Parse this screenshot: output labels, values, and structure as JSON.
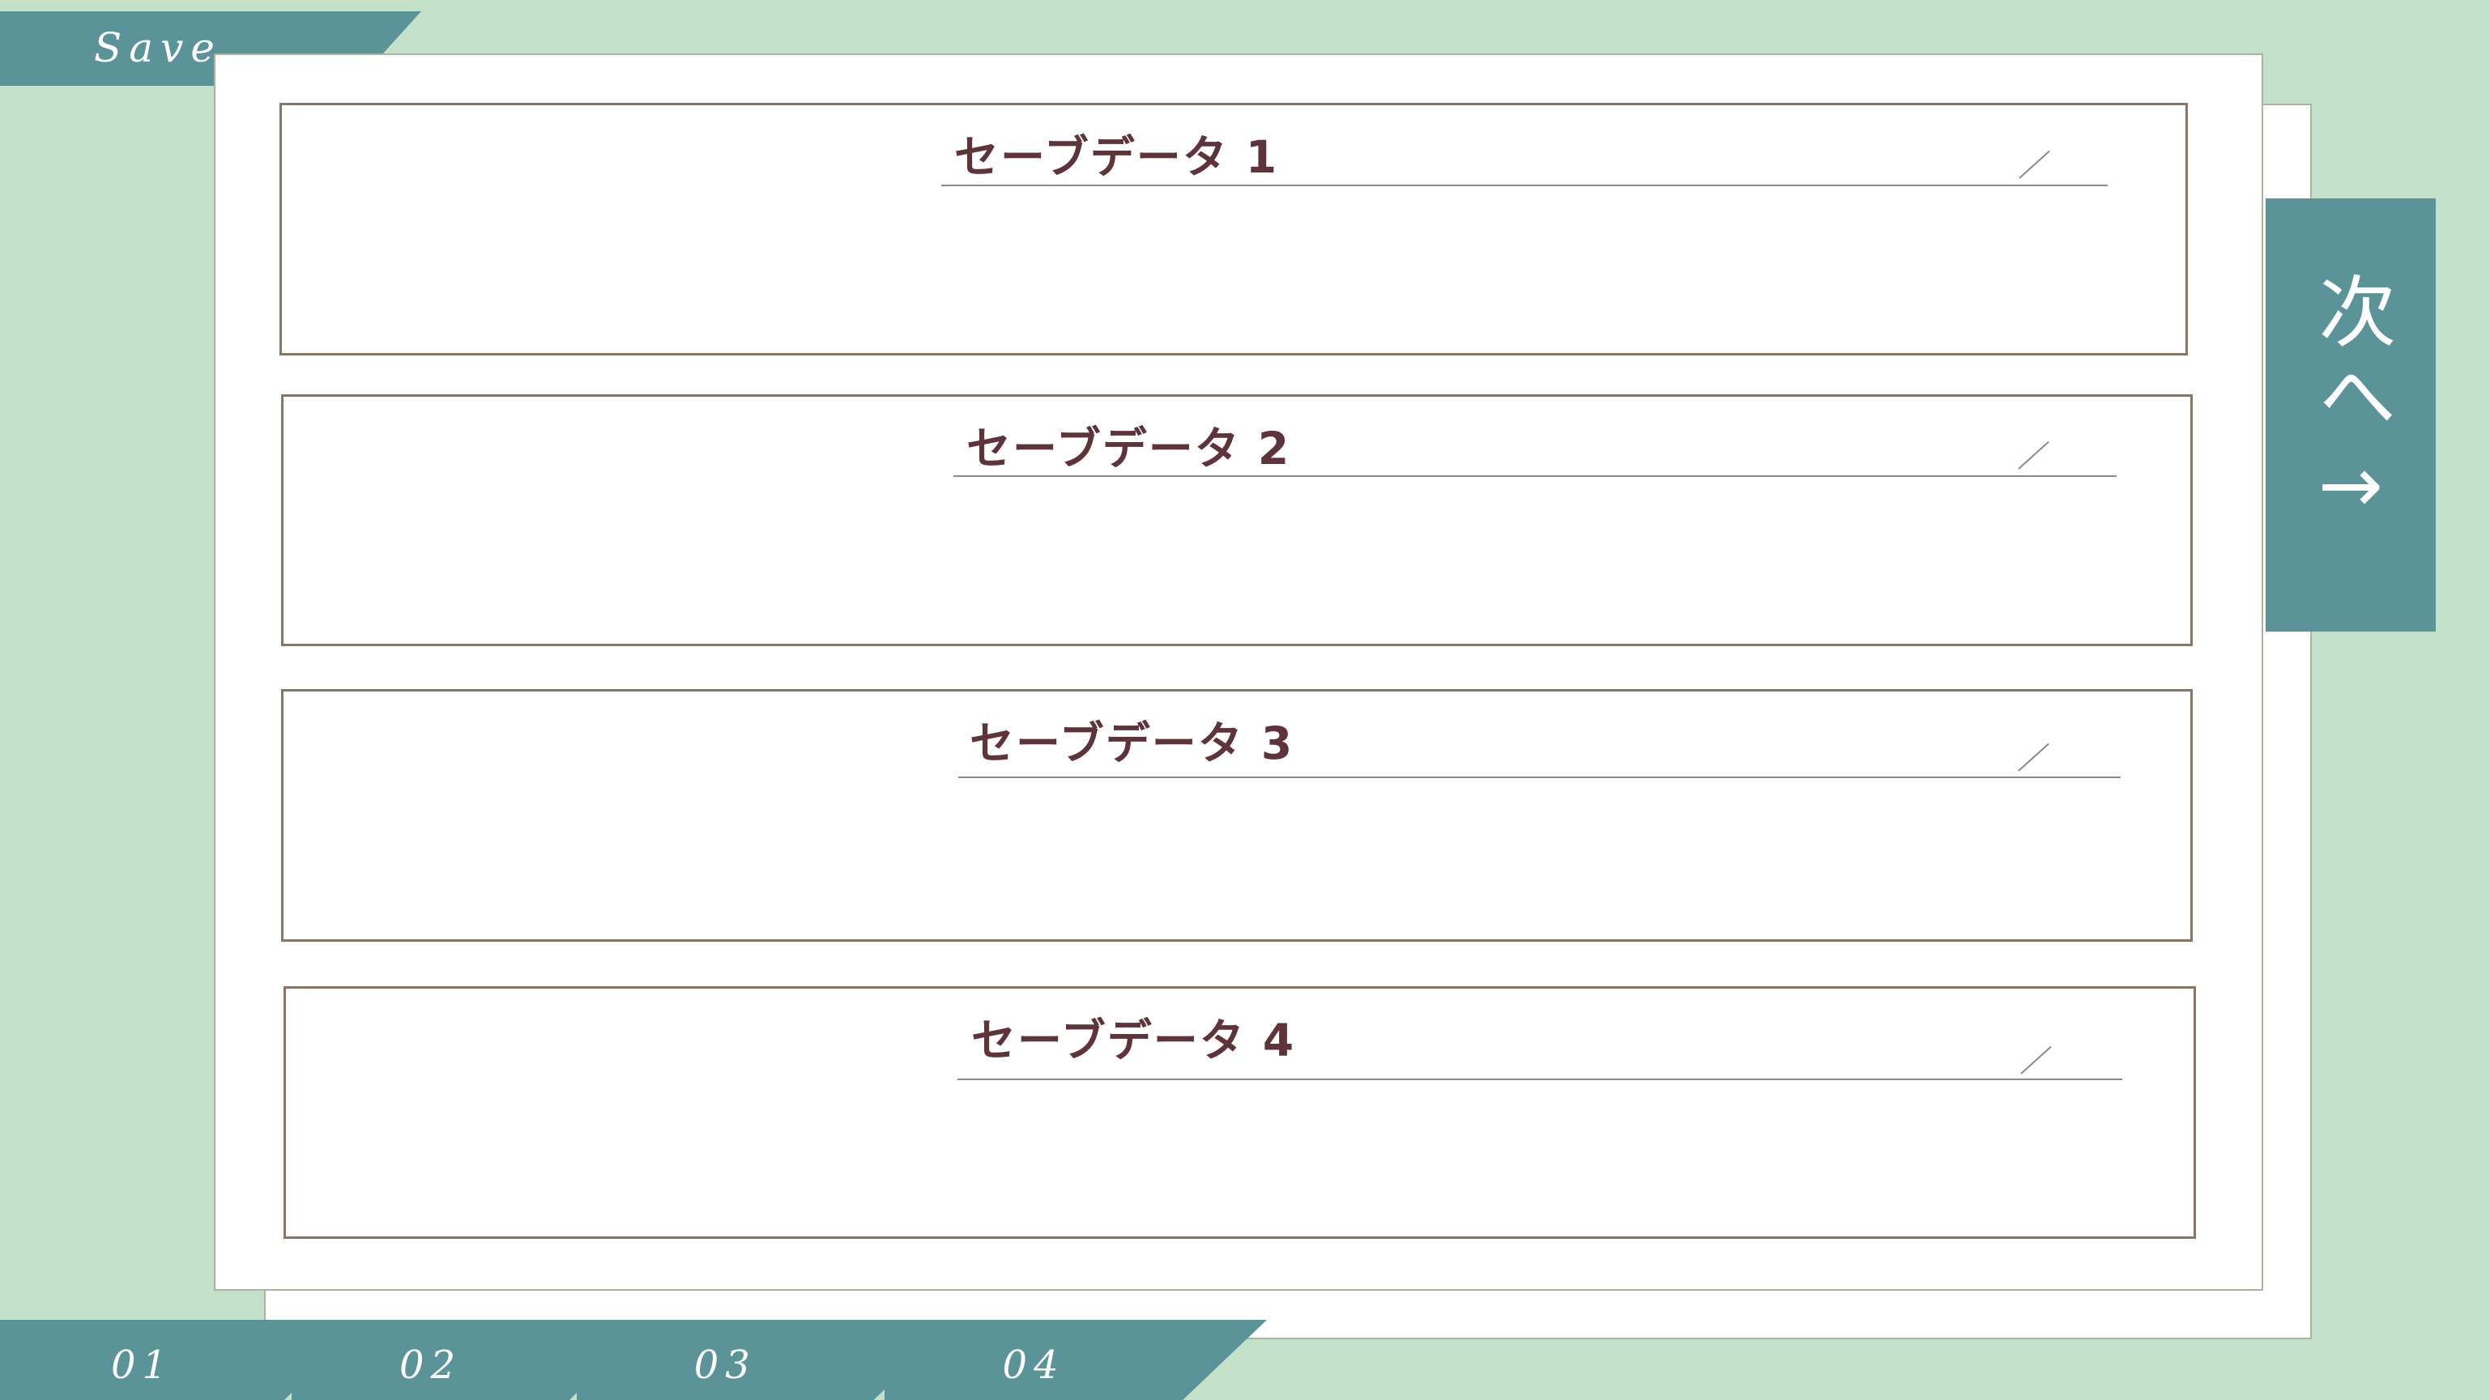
{
  "header": {
    "title": "Save"
  },
  "slots": [
    {
      "label": "セーブデータ 1"
    },
    {
      "label": "セーブデータ 2"
    },
    {
      "label": "セーブデータ 3"
    },
    {
      "label": "セーブデータ 4"
    }
  ],
  "next_button": {
    "label": "次へ→"
  },
  "pages": [
    {
      "label": "01"
    },
    {
      "label": "02"
    },
    {
      "label": "03"
    },
    {
      "label": "04"
    }
  ],
  "colors": {
    "background": "#c3e1c8",
    "accent": "#5a9499",
    "slot_border": "#8a7564",
    "label_text": "#5e3339"
  }
}
